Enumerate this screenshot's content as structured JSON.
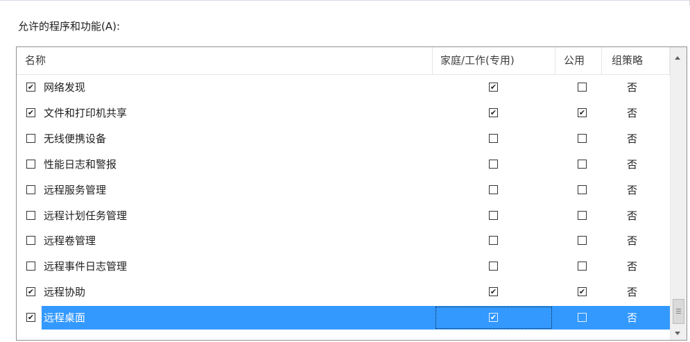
{
  "allowed_label": "允许的程序和功能(A):",
  "columns": {
    "name": "名称",
    "private": "家庭/工作(专用)",
    "public": "公用",
    "group_policy": "组策略"
  },
  "rows": [
    {
      "enabled": true,
      "name": "网络发现",
      "private": true,
      "public": false,
      "group_policy": "否",
      "selected": false
    },
    {
      "enabled": true,
      "name": "文件和打印机共享",
      "private": true,
      "public": true,
      "group_policy": "否",
      "selected": false
    },
    {
      "enabled": false,
      "name": "无线便携设备",
      "private": false,
      "public": false,
      "group_policy": "否",
      "selected": false
    },
    {
      "enabled": false,
      "name": "性能日志和警报",
      "private": false,
      "public": false,
      "group_policy": "否",
      "selected": false
    },
    {
      "enabled": false,
      "name": "远程服务管理",
      "private": false,
      "public": false,
      "group_policy": "否",
      "selected": false
    },
    {
      "enabled": false,
      "name": "远程计划任务管理",
      "private": false,
      "public": false,
      "group_policy": "否",
      "selected": false
    },
    {
      "enabled": false,
      "name": "远程卷管理",
      "private": false,
      "public": false,
      "group_policy": "否",
      "selected": false
    },
    {
      "enabled": false,
      "name": "远程事件日志管理",
      "private": false,
      "public": false,
      "group_policy": "否",
      "selected": false
    },
    {
      "enabled": true,
      "name": "远程协助",
      "private": true,
      "public": true,
      "group_policy": "否",
      "selected": false
    },
    {
      "enabled": true,
      "name": "远程桌面",
      "private": true,
      "public": false,
      "group_policy": "否",
      "selected": true
    }
  ],
  "colors": {
    "selection": "#3399ff",
    "header_text": "#3c3c3c",
    "border": "#8e8f8f"
  },
  "icons": {
    "check": "checkmark-icon",
    "scroll_up": "arrow-up-icon",
    "scroll_down": "arrow-down-icon",
    "scroll_thumb": "scroll-thumb-grip-icon"
  }
}
